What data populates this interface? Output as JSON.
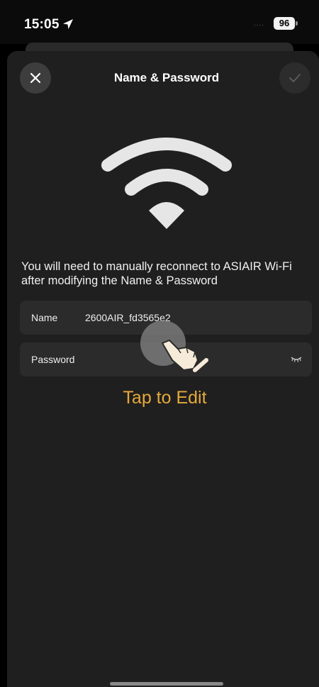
{
  "status_bar": {
    "time": "15:05",
    "signal_dots": "....",
    "battery": "96",
    "location_icon": "location-arrow-icon"
  },
  "sheet": {
    "title": "Name & Password",
    "close_icon": "close-icon",
    "confirm_icon": "checkmark-icon",
    "hero_icon": "wifi-icon",
    "notice": "You will need to manually reconnect to ASIAIR Wi-Fi after modifying the Name & Password",
    "fields": {
      "name": {
        "label": "Name",
        "value": "2600AIR_fd3565e2"
      },
      "password": {
        "label": "Password",
        "value": "",
        "toggle_icon": "eye-closed-icon"
      }
    },
    "tap_hint": "Tap to Edit"
  },
  "colors": {
    "background": "#000000",
    "sheet": "#1f1f1f",
    "field": "#2b2b2b",
    "accent": "#e6a93a",
    "text": "#ffffff"
  }
}
